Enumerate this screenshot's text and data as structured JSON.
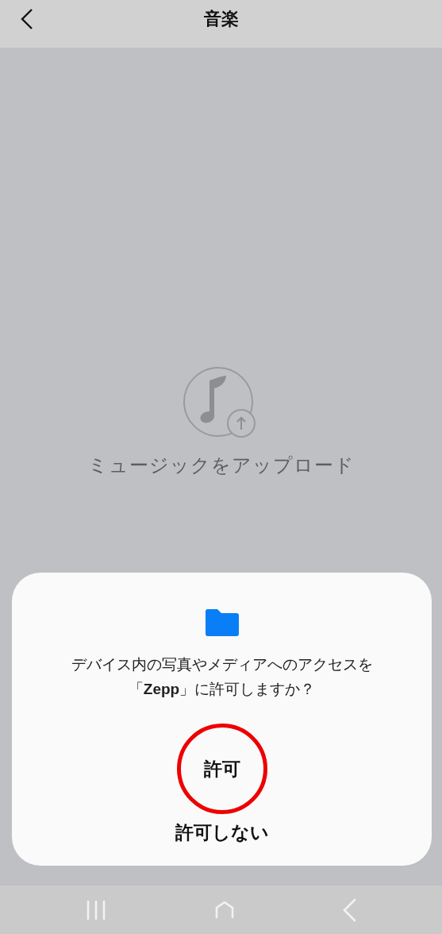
{
  "header": {
    "title": "音楽"
  },
  "empty_state": {
    "label": "ミュージックをアップロード"
  },
  "dialog": {
    "message": "デバイス内の写真やメディアへのアクセスを「**Zepp**」に許可しますか？",
    "buttons": [
      {
        "label": "許可",
        "highlighted": true
      },
      {
        "label": "許可しない",
        "highlighted": false
      }
    ]
  }
}
